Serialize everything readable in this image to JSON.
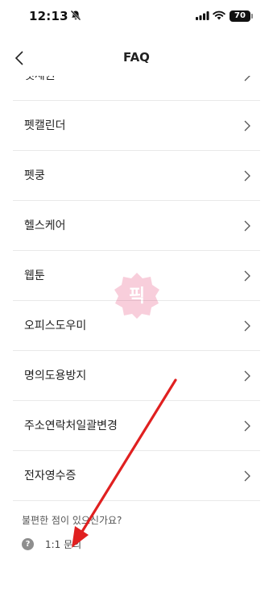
{
  "status": {
    "time": "12:13",
    "battery": "70"
  },
  "header": {
    "title": "FAQ"
  },
  "items": [
    {
      "label": "펫세권"
    },
    {
      "label": "펫캘린더"
    },
    {
      "label": "펫쿵"
    },
    {
      "label": "헬스케어"
    },
    {
      "label": "웹툰"
    },
    {
      "label": "오피스도우미"
    },
    {
      "label": "명의도용방지"
    },
    {
      "label": "주소연락처일괄변경"
    },
    {
      "label": "전자영수증"
    }
  ],
  "footer": {
    "question": "불편한 점이 있으신가요?",
    "inquiry_label": "1:1 문의",
    "inquiry_icon": "?"
  },
  "watermark": {
    "text": "픽"
  },
  "colors": {
    "annotation_arrow": "#e02020",
    "divider": "#e9e9e9",
    "help_icon": "#8e8e8e"
  }
}
